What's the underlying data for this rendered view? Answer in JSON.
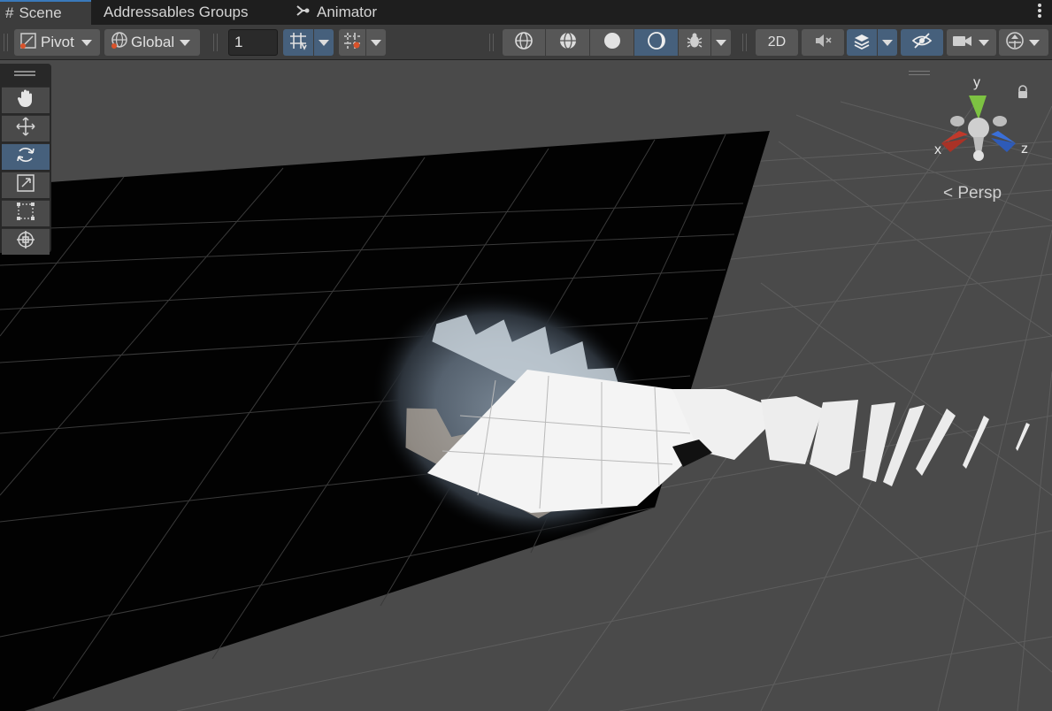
{
  "tabs": [
    {
      "label": "Scene",
      "icon": "grid-hash-icon",
      "active": true
    },
    {
      "label": "Addressables Groups",
      "active": false
    },
    {
      "label": "Animator",
      "icon": "animator-icon",
      "active": false
    }
  ],
  "toolbar": {
    "pivot_label": "Pivot",
    "global_label": "Global",
    "grid_size_value": "1",
    "mode_2d_label": "2D"
  },
  "tools": [
    {
      "name": "hand-tool",
      "icon": "hand-icon",
      "active": false
    },
    {
      "name": "move-tool",
      "icon": "move-arrows-icon",
      "active": false
    },
    {
      "name": "rotate-tool",
      "icon": "rotate-icon",
      "active": true
    },
    {
      "name": "scale-tool",
      "icon": "scale-icon",
      "active": false
    },
    {
      "name": "rect-tool",
      "icon": "rect-icon",
      "active": false
    },
    {
      "name": "transform-tool",
      "icon": "transform-icon",
      "active": false
    }
  ],
  "gizmo": {
    "y_label": "y",
    "x_label": "x",
    "z_label": "z",
    "projection_label": "< Persp"
  },
  "colors": {
    "accent_blue": "#46607c",
    "tab_highlight": "#3a79bb",
    "axis_x": "#c0392b",
    "axis_y": "#7dc242",
    "axis_z": "#3a6fd8"
  }
}
